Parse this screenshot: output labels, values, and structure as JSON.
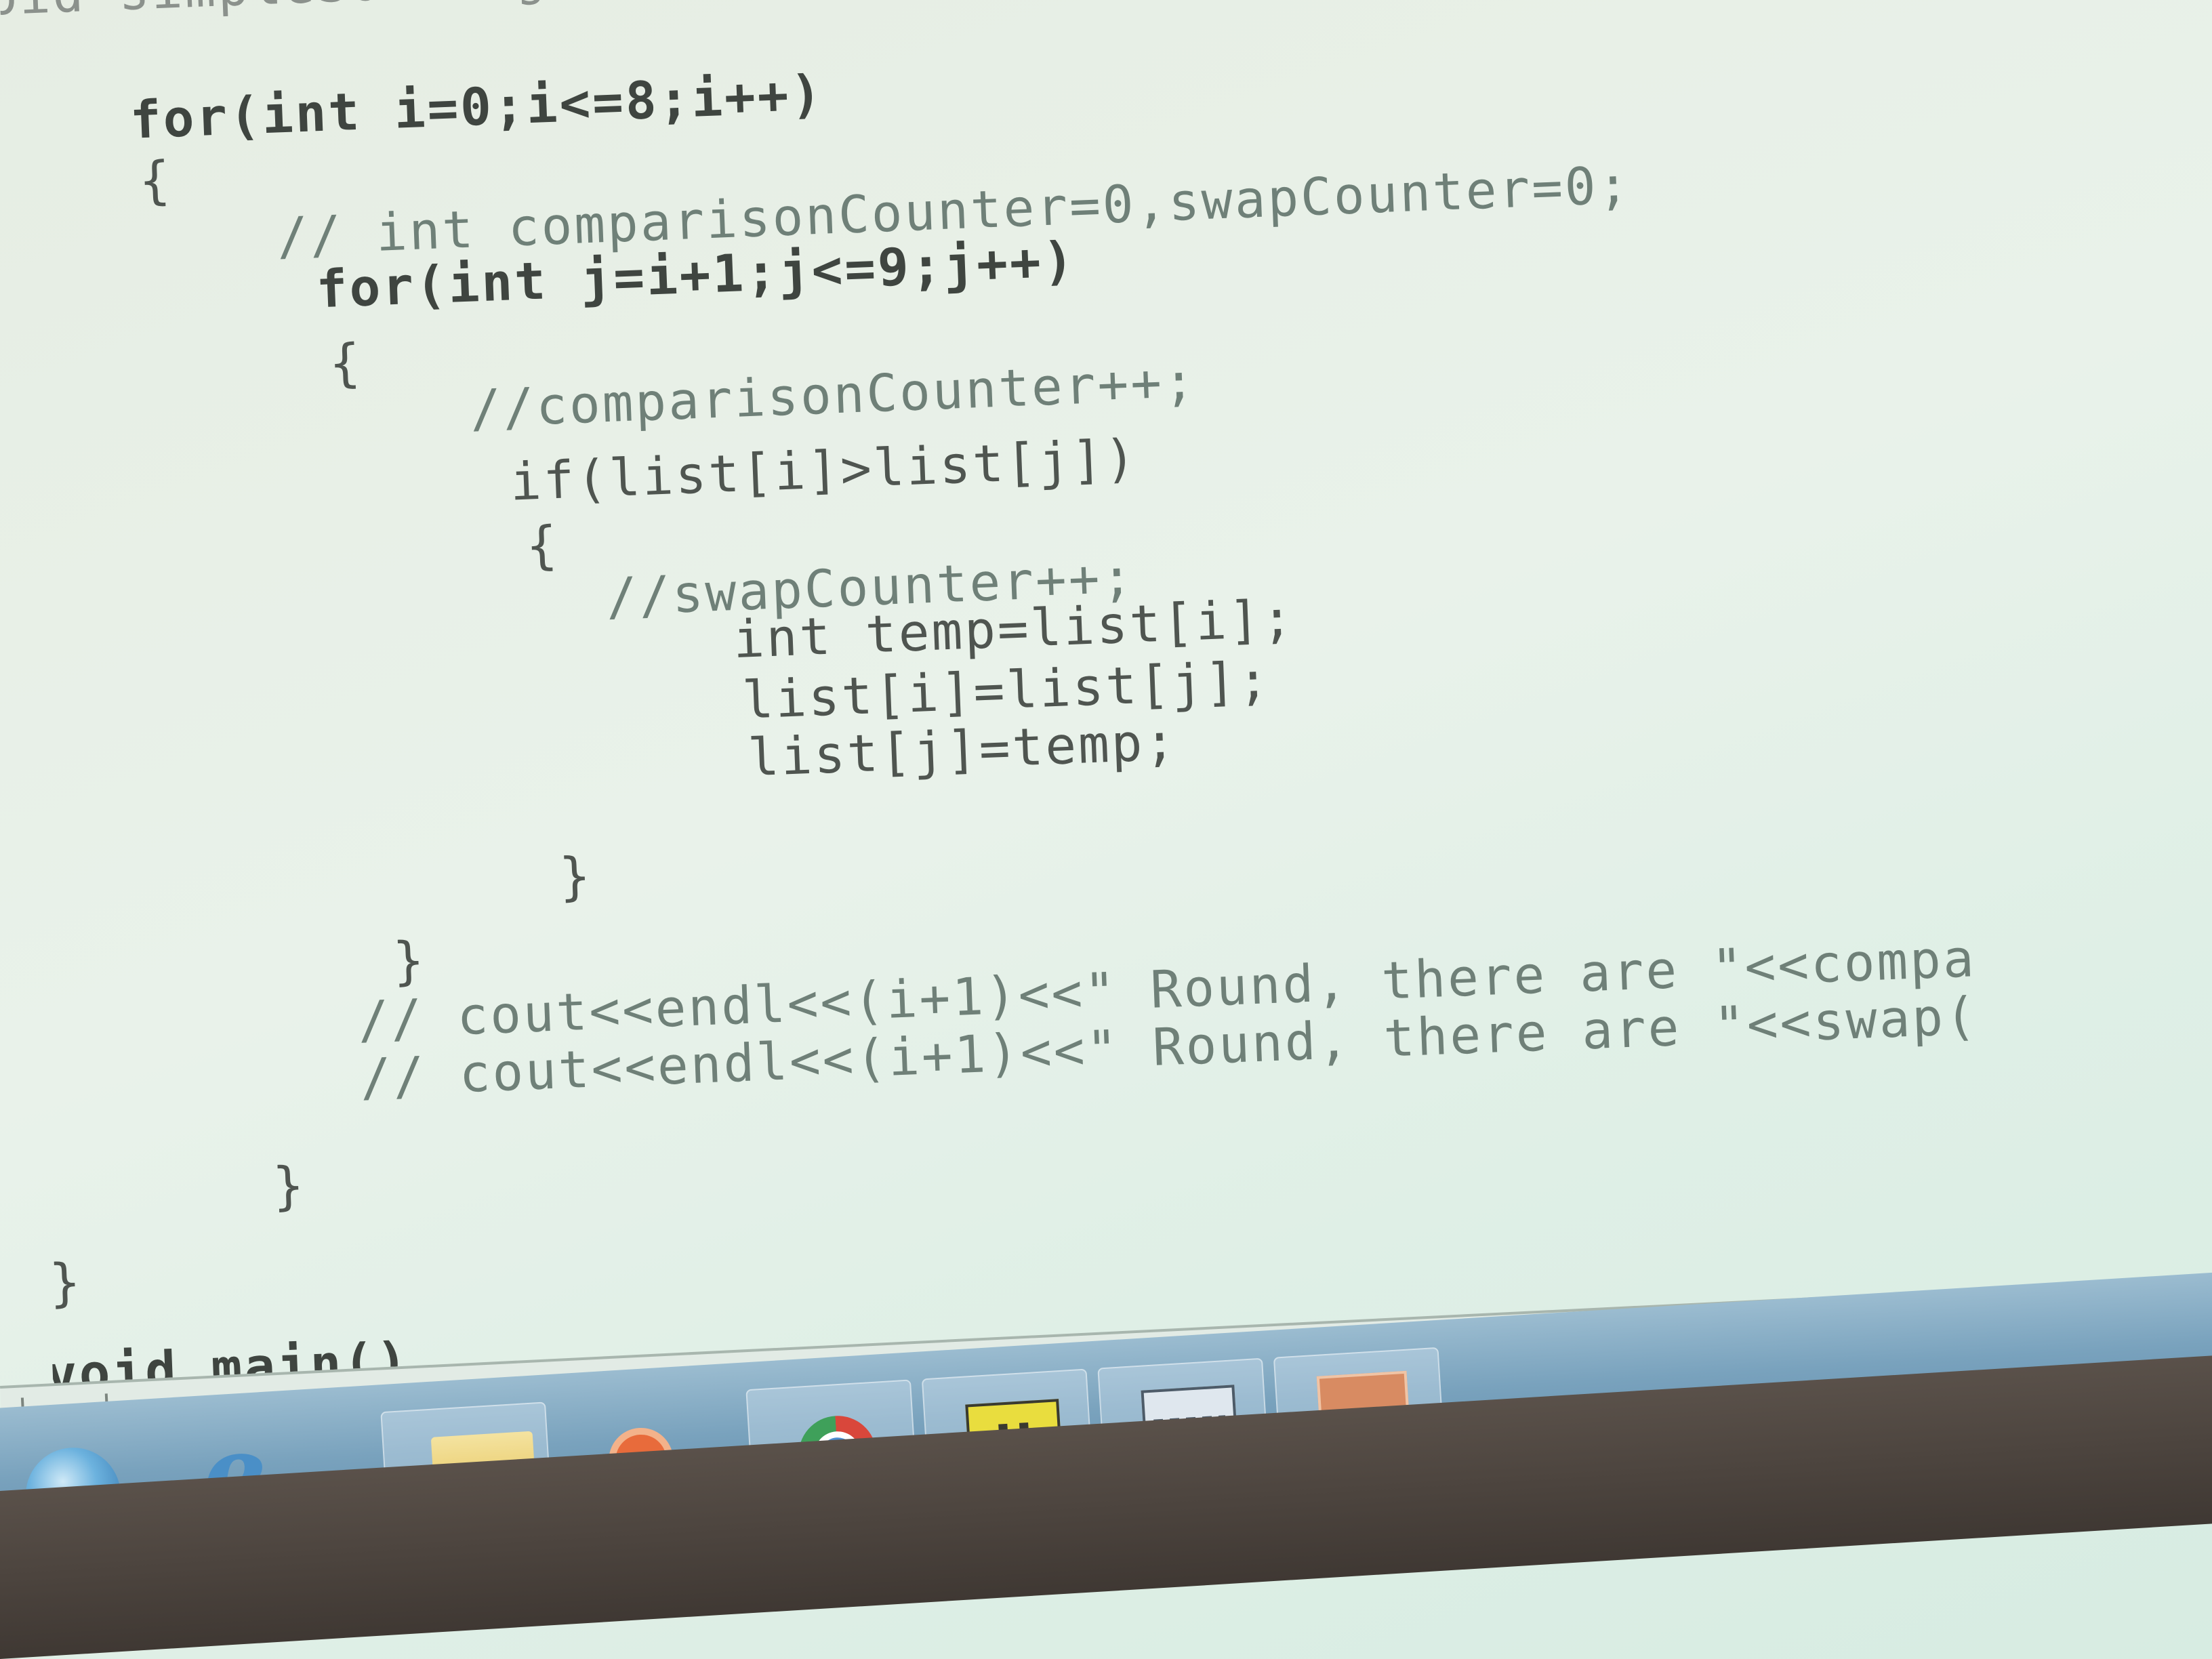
{
  "editor": {
    "lines": [
      "oid simpleSorting(int list[])",
      "for(int i=0;i<=8;i++)",
      "{",
      "// int comparisonCounter=0,swapCounter=0;",
      "for(int j=i+1;j<=9;j++)",
      "{",
      "//comparisonCounter++;",
      "if(list[i]>list[j])",
      "{",
      "//swapCounter++;",
      "int temp=list[i];",
      "list[i]=list[j];",
      "list[j]=temp;",
      "}",
      "}",
      "// cout<<endl<<(i+1)<<\" Round, there are \"<<compa",
      "// cout<<endl<<(i+1)<<\" Round, there are \"<<swap(",
      "}",
      "}",
      "void main()"
    ]
  },
  "taskbar": {
    "icons": [
      "start-orb-icon",
      "internet-explorer-icon",
      "folder-icon",
      "media-player-icon",
      "chrome-icon",
      "tool-icon",
      "calculator-icon",
      "app-icon"
    ],
    "tool_icon_text": "U",
    "colors": {
      "bar": "#79a2bd",
      "code": "#4f5550",
      "comment": "#6f8078"
    }
  }
}
